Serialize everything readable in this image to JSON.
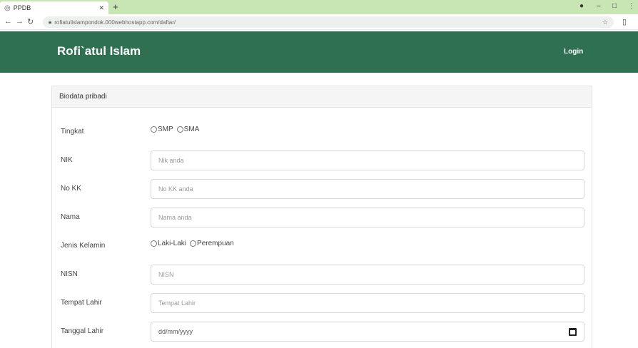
{
  "browser": {
    "tab_title": "PPDB",
    "url": "rofiatulislampondok.000webhostapp.com/daftar/"
  },
  "header": {
    "brand": "Rofi`atul Islam",
    "login": "Login"
  },
  "card": {
    "title": "Biodata pribadi"
  },
  "form": {
    "tingkat": {
      "label": "Tingkat",
      "options": [
        "SMP",
        "SMA"
      ]
    },
    "nik": {
      "label": "NIK",
      "placeholder": "Nik anda"
    },
    "nokk": {
      "label": "No KK",
      "placeholder": "No KK anda"
    },
    "nama": {
      "label": "Nama",
      "placeholder": "Nama anda"
    },
    "jenis_kelamin": {
      "label": "Jenis Kelamin",
      "options": [
        "Laki-Laki",
        "Perempuan"
      ]
    },
    "nisn": {
      "label": "NISN",
      "placeholder": "NISN"
    },
    "tempat_lahir": {
      "label": "Tempat Lahir",
      "placeholder": "Tempat Lahir"
    },
    "tanggal_lahir": {
      "label": "Tanggal Lahir",
      "placeholder": "dd/mm/yyyy"
    }
  }
}
